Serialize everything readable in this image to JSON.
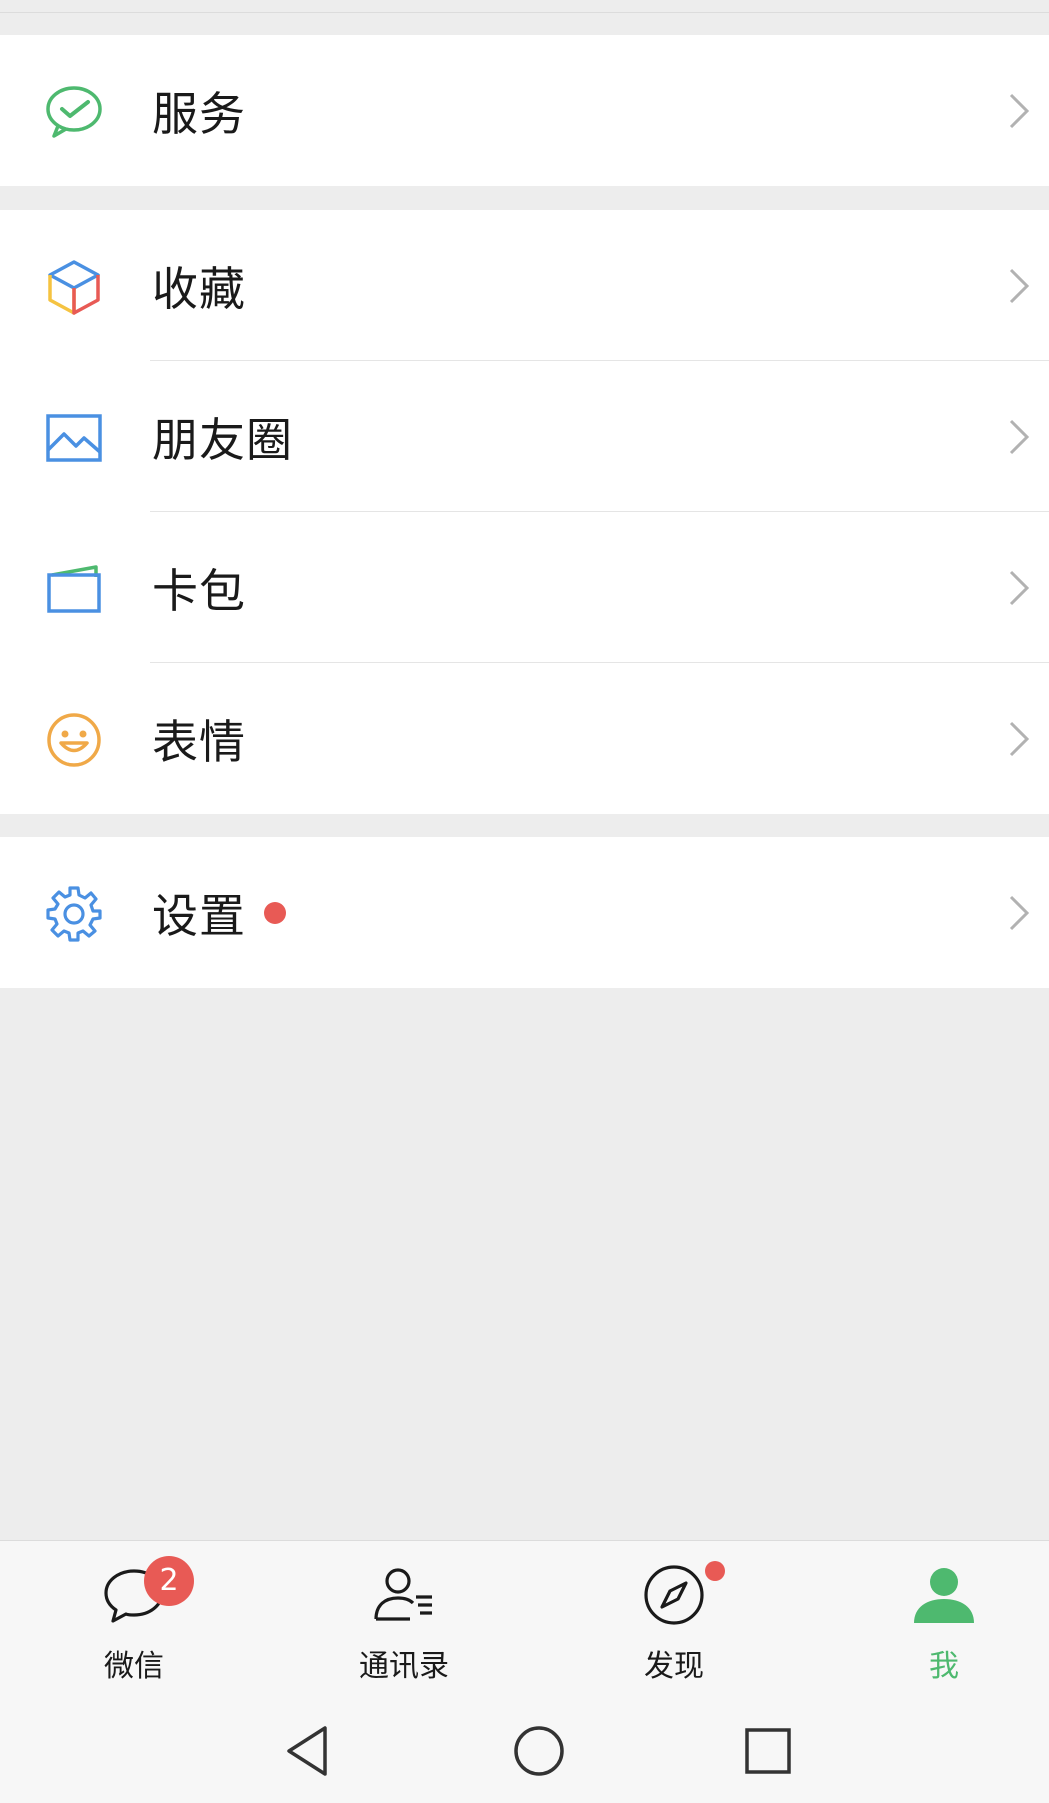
{
  "colors": {
    "background": "#ededed",
    "card": "#ffffff",
    "accent_green": "#4eb96f",
    "badge_red": "#e85a55",
    "chevron": "#b2b2b2"
  },
  "menu": {
    "service": {
      "label": "服务",
      "icon": "wechat-pay-check-icon"
    },
    "favorites": {
      "label": "收藏",
      "icon": "cube-icon"
    },
    "moments": {
      "label": "朋友圈",
      "icon": "picture-icon"
    },
    "cards": {
      "label": "卡包",
      "icon": "card-wallet-icon"
    },
    "stickers": {
      "label": "表情",
      "icon": "smiley-icon"
    },
    "settings": {
      "label": "设置",
      "icon": "gear-icon",
      "has_new_dot": true
    }
  },
  "tabbar": {
    "tabs": [
      {
        "label": "微信",
        "icon": "chat-bubble-icon",
        "badge": "2",
        "active": false
      },
      {
        "label": "通讯录",
        "icon": "contacts-icon",
        "active": false
      },
      {
        "label": "发现",
        "icon": "compass-icon",
        "has_dot": true,
        "active": false
      },
      {
        "label": "我",
        "icon": "person-icon",
        "active": true
      }
    ]
  },
  "system_nav": {
    "buttons": [
      "back-triangle-icon",
      "home-circle-icon",
      "recents-square-icon"
    ]
  }
}
